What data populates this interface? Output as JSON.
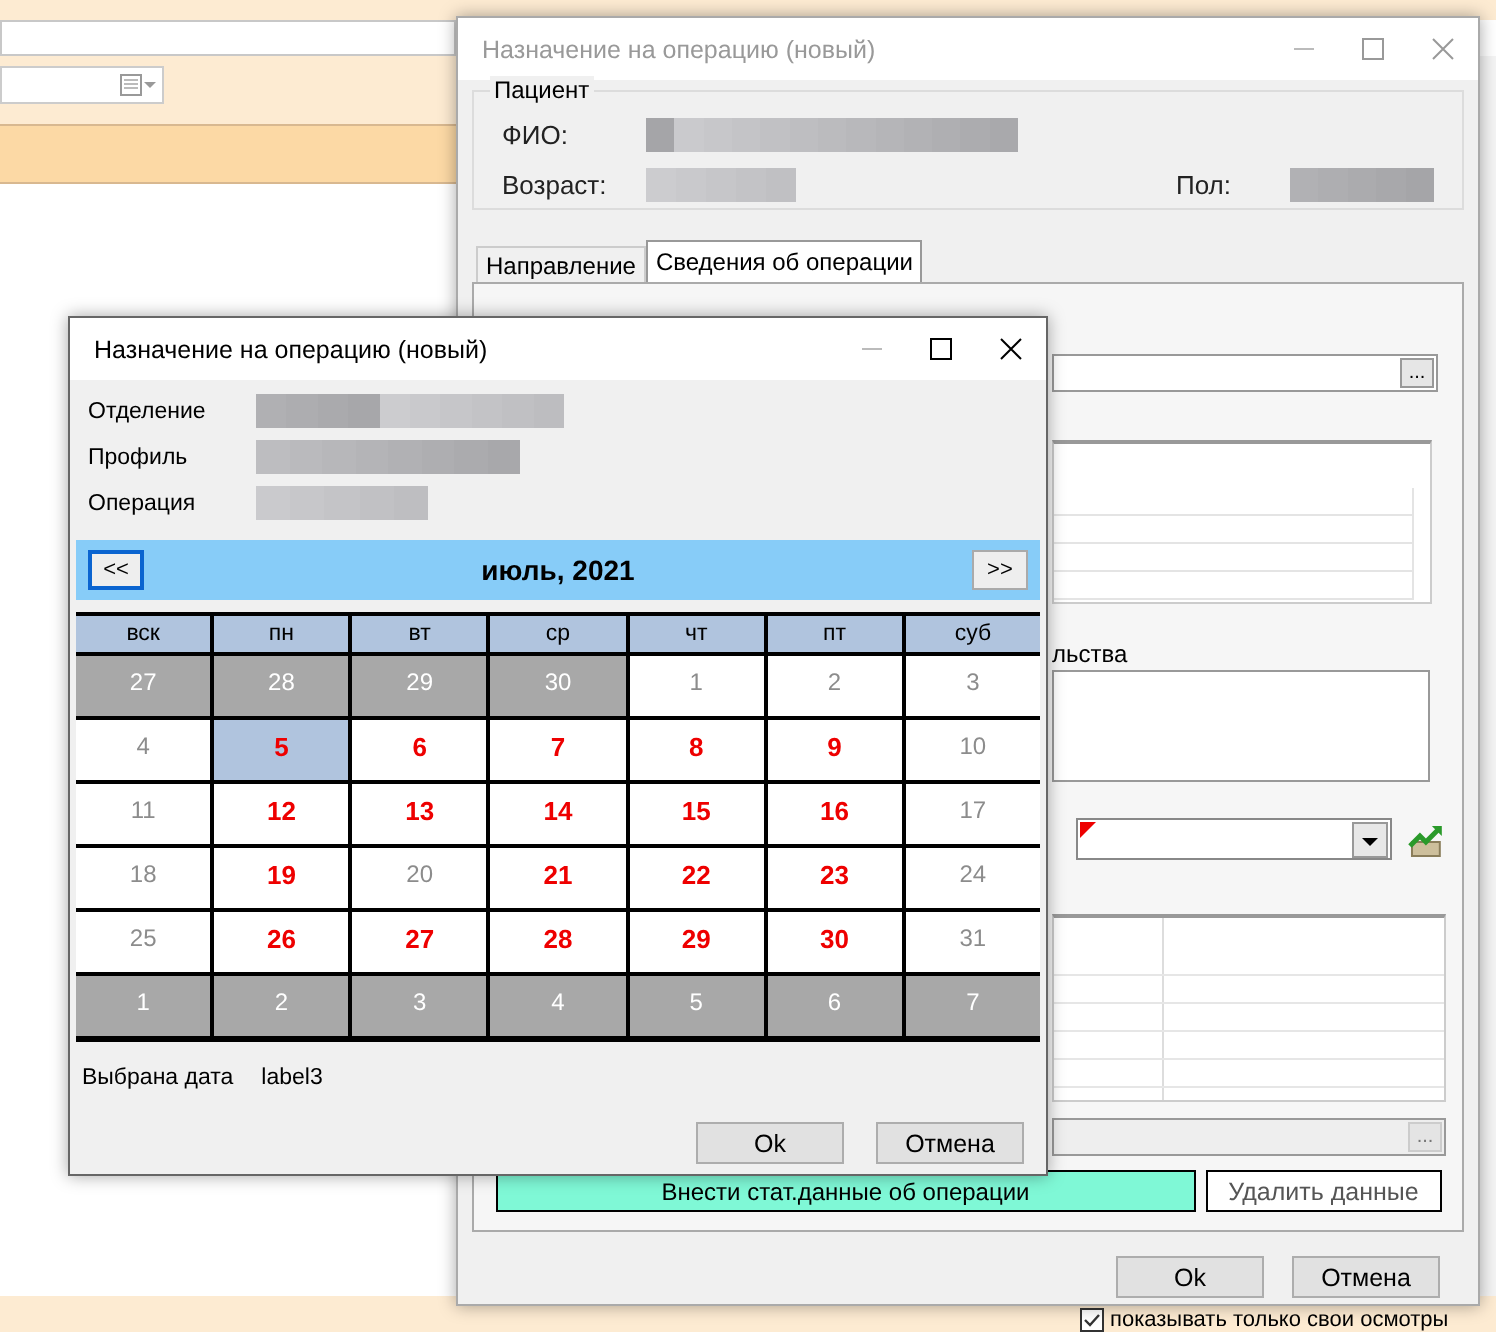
{
  "background_app": {
    "checkbox": {
      "label": "показывать только свои осмотры",
      "checked": true
    }
  },
  "back_window": {
    "title": "Назначение на операцию (новый)",
    "patient_group": {
      "legend": "Пациент",
      "rows": [
        [
          {
            "label": "ФИО:"
          }
        ],
        [
          {
            "label": "Возраст:"
          },
          {
            "label": "Пол:"
          }
        ]
      ]
    },
    "tabs": [
      {
        "label": "Направление",
        "selected": false
      },
      {
        "label": "Сведения об операции",
        "selected": true
      }
    ],
    "browse_buttons": [
      {
        "label": "...",
        "disabled": false
      },
      {
        "label": "...",
        "disabled": true
      }
    ],
    "partial_label": "льства",
    "primary_button": "Внести стат.данные об операции",
    "delete_button": "Удалить данные",
    "buttons": [
      "Ok",
      "Отмена"
    ]
  },
  "front_window": {
    "title": "Назначение на операцию (новый)",
    "fields": [
      {
        "label": "Отделение"
      },
      {
        "label": "Профиль"
      },
      {
        "label": "Операция"
      }
    ],
    "calendar": {
      "prev": "<<",
      "month": "июль, 2021",
      "next": ">>",
      "weekdays": [
        "вск",
        "пн",
        "вт",
        "ср",
        "чт",
        "пт",
        "суб"
      ],
      "weeks": [
        [
          {
            "day": "27",
            "kind": "other",
            "selected": false
          },
          {
            "day": "28",
            "kind": "other",
            "selected": false
          },
          {
            "day": "29",
            "kind": "other",
            "selected": false
          },
          {
            "day": "30",
            "kind": "other",
            "selected": false
          },
          {
            "day": "1",
            "kind": "off",
            "selected": false
          },
          {
            "day": "2",
            "kind": "off",
            "selected": false
          },
          {
            "day": "3",
            "kind": "off",
            "selected": false
          }
        ],
        [
          {
            "day": "4",
            "kind": "off",
            "selected": false
          },
          {
            "day": "5",
            "kind": "work",
            "selected": true
          },
          {
            "day": "6",
            "kind": "work",
            "selected": false
          },
          {
            "day": "7",
            "kind": "work",
            "selected": false
          },
          {
            "day": "8",
            "kind": "work",
            "selected": false
          },
          {
            "day": "9",
            "kind": "work",
            "selected": false
          },
          {
            "day": "10",
            "kind": "off",
            "selected": false
          }
        ],
        [
          {
            "day": "11",
            "kind": "off",
            "selected": false
          },
          {
            "day": "12",
            "kind": "work",
            "selected": false
          },
          {
            "day": "13",
            "kind": "work",
            "selected": false
          },
          {
            "day": "14",
            "kind": "work",
            "selected": false
          },
          {
            "day": "15",
            "kind": "work",
            "selected": false
          },
          {
            "day": "16",
            "kind": "work",
            "selected": false
          },
          {
            "day": "17",
            "kind": "off",
            "selected": false
          }
        ],
        [
          {
            "day": "18",
            "kind": "off",
            "selected": false
          },
          {
            "day": "19",
            "kind": "work",
            "selected": false
          },
          {
            "day": "20",
            "kind": "off",
            "selected": false
          },
          {
            "day": "21",
            "kind": "work",
            "selected": false
          },
          {
            "day": "22",
            "kind": "work",
            "selected": false
          },
          {
            "day": "23",
            "kind": "work",
            "selected": false
          },
          {
            "day": "24",
            "kind": "off",
            "selected": false
          }
        ],
        [
          {
            "day": "25",
            "kind": "off",
            "selected": false
          },
          {
            "day": "26",
            "kind": "work",
            "selected": false
          },
          {
            "day": "27",
            "kind": "work",
            "selected": false
          },
          {
            "day": "28",
            "kind": "work",
            "selected": false
          },
          {
            "day": "29",
            "kind": "work",
            "selected": false
          },
          {
            "day": "30",
            "kind": "work",
            "selected": false
          },
          {
            "day": "31",
            "kind": "off",
            "selected": false
          }
        ],
        [
          {
            "day": "1",
            "kind": "other",
            "selected": false
          },
          {
            "day": "2",
            "kind": "other",
            "selected": false
          },
          {
            "day": "3",
            "kind": "other",
            "selected": false
          },
          {
            "day": "4",
            "kind": "other",
            "selected": false
          },
          {
            "day": "5",
            "kind": "other",
            "selected": false
          },
          {
            "day": "6",
            "kind": "other",
            "selected": false
          },
          {
            "day": "7",
            "kind": "other",
            "selected": false
          }
        ]
      ]
    },
    "selected_date_label": "Выбрана дата",
    "selected_date_value": "label3",
    "buttons": [
      "Ok",
      "Отмена"
    ]
  }
}
